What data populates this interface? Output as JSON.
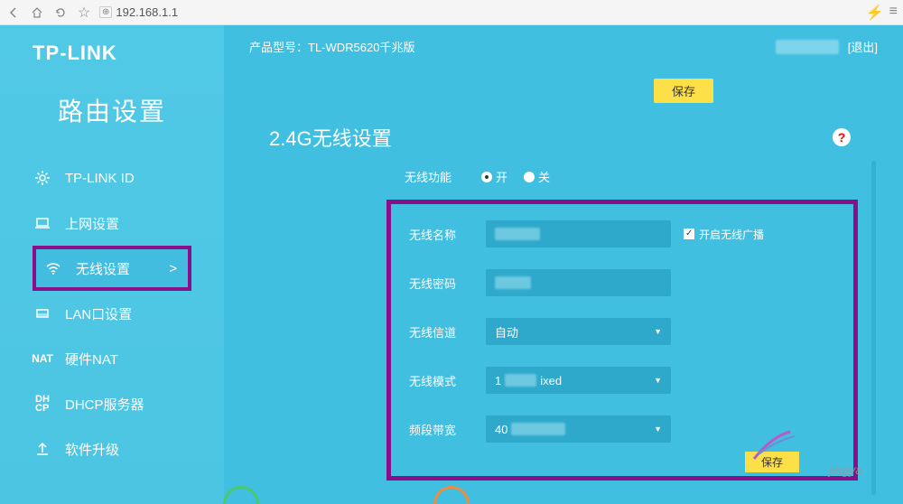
{
  "browser": {
    "url": "192.168.1.1"
  },
  "logo": "TP-LINK",
  "sidebar": {
    "title": "路由设置",
    "items": [
      {
        "label": "TP-LINK ID"
      },
      {
        "label": "上网设置"
      },
      {
        "label": "无线设置"
      },
      {
        "label": "LAN口设置"
      },
      {
        "label": "硬件NAT"
      },
      {
        "label": "DHCP服务器"
      },
      {
        "label": "软件升级"
      }
    ]
  },
  "header": {
    "model_label": "产品型号：",
    "model": "TL-WDR5620千兆版",
    "logout": "[退出]"
  },
  "buttons": {
    "save": "保存",
    "save2": "保存"
  },
  "section": {
    "title": "2.4G无线设置",
    "help": "?"
  },
  "form": {
    "wireless_function": "无线功能",
    "on": "开",
    "off": "关",
    "wireless_name": "无线名称",
    "enable_broadcast": "开启无线广播",
    "wireless_password": "无线密码",
    "wireless_channel": "无线信道",
    "channel_value": "自动",
    "wireless_mode": "无线模式",
    "mode_prefix": "1",
    "mode_suffix": "ixed",
    "bandwidth": "频段带宽",
    "bandwidth_value": "40"
  },
  "watermark": "jingya"
}
